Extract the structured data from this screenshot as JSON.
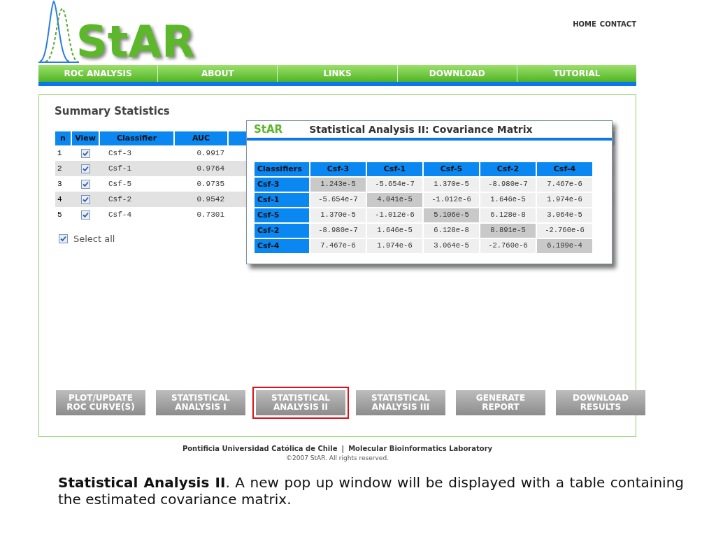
{
  "logo": {
    "text": "StAR"
  },
  "top_links": [
    "HOME",
    "CONTACT"
  ],
  "nav": [
    {
      "label": "ROC ANALYSIS"
    },
    {
      "label": "ABOUT"
    },
    {
      "label": "LINKS"
    },
    {
      "label": "DOWNLOAD"
    },
    {
      "label": "TUTORIAL"
    }
  ],
  "summary": {
    "title": "Summary Statistics",
    "columns": [
      "n",
      "View",
      "Classifier",
      "AUC"
    ],
    "rows": [
      {
        "n": "1",
        "checked": true,
        "classifier": "Csf-3",
        "auc": "0.9917"
      },
      {
        "n": "2",
        "checked": true,
        "classifier": "Csf-1",
        "auc": "0.9764"
      },
      {
        "n": "3",
        "checked": true,
        "classifier": "Csf-5",
        "auc": "0.9735"
      },
      {
        "n": "4",
        "checked": true,
        "classifier": "Csf-2",
        "auc": "0.9542"
      },
      {
        "n": "5",
        "checked": true,
        "classifier": "Csf-4",
        "auc": "0.7301"
      }
    ],
    "select_all": {
      "label": "Select all",
      "checked": true
    }
  },
  "popup": {
    "brand": "StAR",
    "title": "Statistical Analysis II: Covariance Matrix",
    "columns": [
      "Classifiers",
      "Csf-3",
      "Csf-1",
      "Csf-5",
      "Csf-2",
      "Csf-4"
    ],
    "rows": [
      {
        "label": "Csf-3",
        "values": [
          "1.243e-5",
          "-5.654e-7",
          "1.370e-5",
          "-8.980e-7",
          "7.467e-6"
        ]
      },
      {
        "label": "Csf-1",
        "values": [
          "-5.654e-7",
          "4.041e-5",
          "-1.012e-6",
          "1.646e-5",
          "1.974e-6"
        ]
      },
      {
        "label": "Csf-5",
        "values": [
          "1.370e-5",
          "-1.012e-6",
          "5.106e-5",
          "6.128e-8",
          "3.064e-5"
        ]
      },
      {
        "label": "Csf-2",
        "values": [
          "-8.980e-7",
          "1.646e-5",
          "6.128e-8",
          "8.891e-5",
          "-2.760e-6"
        ]
      },
      {
        "label": "Csf-4",
        "values": [
          "7.467e-6",
          "1.974e-6",
          "3.064e-5",
          "-2.760e-6",
          "6.199e-4"
        ]
      }
    ]
  },
  "buttons": [
    {
      "lines": [
        "PLOT/UPDATE",
        "ROC CURVE(S)"
      ],
      "selected": false
    },
    {
      "lines": [
        "STATISTICAL",
        "ANALYSIS I"
      ],
      "selected": false
    },
    {
      "lines": [
        "STATISTICAL",
        "ANALYSIS II"
      ],
      "selected": true
    },
    {
      "lines": [
        "STATISTICAL",
        "ANALYSIS III"
      ],
      "selected": false
    },
    {
      "lines": [
        "GENERATE",
        "REPORT"
      ],
      "selected": false
    },
    {
      "lines": [
        "DOWNLOAD",
        "RESULTS"
      ],
      "selected": false
    }
  ],
  "footer": {
    "links": [
      "Pontificia Universidad Católica de Chile",
      "|",
      "Molecular Bioinformatics Laboratory"
    ],
    "copyright": "©2007 StAR. All rights reserved."
  },
  "caption": "**Statistical Analysis II**. A new pop up window will be displayed with a table containing the estimated covariance matrix."
}
